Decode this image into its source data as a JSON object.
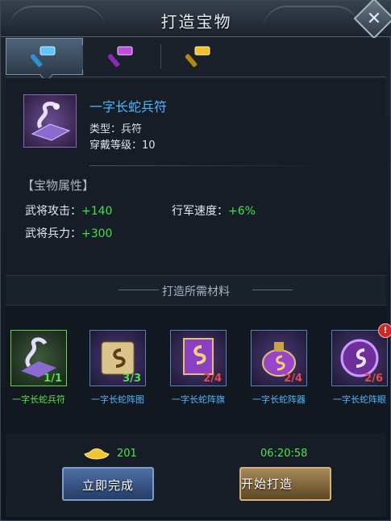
{
  "window": {
    "title": "打造宝物"
  },
  "tabs": [
    {
      "name": "blue-hammer"
    },
    {
      "name": "purple-hammer"
    },
    {
      "name": "gold-hammer"
    }
  ],
  "item": {
    "name": "一字长蛇兵符",
    "type_line": "类型：兵符",
    "level_line": "穿戴等级：10"
  },
  "attributes": {
    "header": "【宝物属性】",
    "rows": [
      {
        "label": "武将攻击：",
        "value": "+140"
      },
      {
        "label": "行军速度：",
        "value": "+6%"
      },
      {
        "label": "武将兵力：",
        "value": "+300"
      }
    ]
  },
  "materials": {
    "header": "打造所需材料",
    "items": [
      {
        "label": "一字长蛇兵符",
        "count": "1/1",
        "state": "ok"
      },
      {
        "label": "一字长蛇阵图",
        "count": "3/3",
        "state": "ok"
      },
      {
        "label": "一字长蛇阵旗",
        "count": "2/4",
        "state": "bad"
      },
      {
        "label": "一字长蛇阵器",
        "count": "2/4",
        "state": "bad"
      },
      {
        "label": "一字长蛇阵眼",
        "count": "2/6",
        "state": "bad",
        "alert": "!"
      }
    ]
  },
  "footer": {
    "gold": "201",
    "timer": "06:20:58",
    "finish_now": "立即完成",
    "start_forge": "开始打造"
  },
  "colors": {
    "accent_blue": "#4fb6ff",
    "green": "#52e24a",
    "red": "#e54a4a"
  }
}
